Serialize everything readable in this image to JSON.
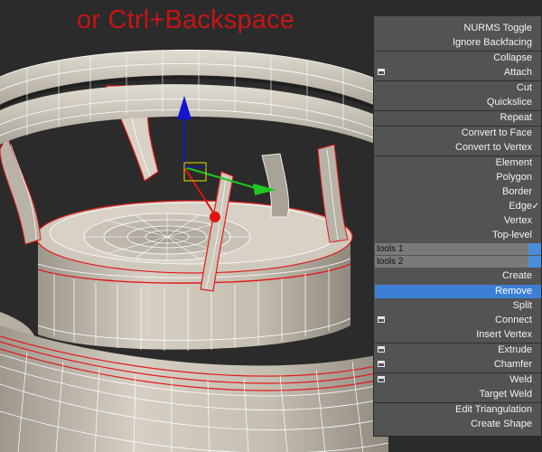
{
  "caption": "or Ctrl+Backspace",
  "colors": {
    "viewport_bg": "#2b2b2b",
    "mesh_face": "#c9c3b6",
    "mesh_wire": "#ffffff",
    "selection_edge": "#e21a1a",
    "menu_bg": "#535353",
    "highlight": "#3e7fd6",
    "caption": "#c81414",
    "gizmo_y": "#1414ce",
    "gizmo_x": "#1ec81e",
    "gizmo_z": "#e01414"
  },
  "menu": {
    "nurms_toggle": "NURMS Toggle",
    "ignore_backfacing": "Ignore Backfacing",
    "collapse": "Collapse",
    "attach": "Attach",
    "cut": "Cut",
    "quickslice": "Quickslice",
    "repeat": "Repeat",
    "convert_to_face": "Convert to Face",
    "convert_to_vertex": "Convert to Vertex",
    "element": "Element",
    "polygon": "Polygon",
    "border": "Border",
    "edge": "Edge",
    "vertex_level": "Vertex",
    "top_level": "Top-level",
    "tools1": "tools 1",
    "tools2": "tools 2",
    "create": "Create",
    "remove": "Remove",
    "split": "Split",
    "connect": "Connect",
    "insert_vertex": "Insert Vertex",
    "extrude": "Extrude",
    "chamfer": "Chamfer",
    "weld": "Weld",
    "target_weld": "Target Weld",
    "edit_triangulation": "Edit Triangulation",
    "create_shape": "Create Shape",
    "checked_item": "Edge",
    "highlighted_item": "Remove"
  },
  "icons": {
    "checkmark": "checkmark-icon",
    "settings_box": "settings-box-icon"
  }
}
